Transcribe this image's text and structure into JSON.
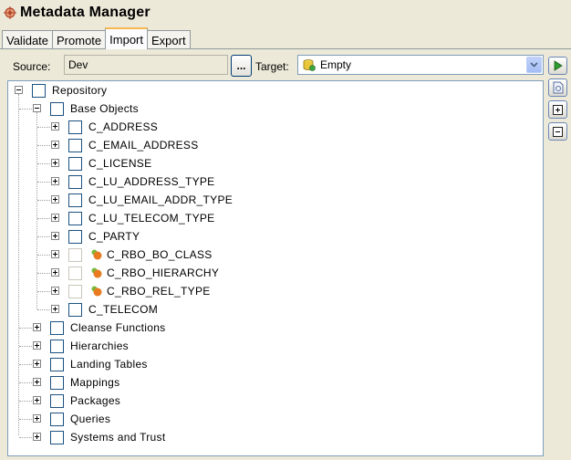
{
  "app": {
    "title": "Metadata Manager"
  },
  "tabs": [
    {
      "label": "Validate",
      "active": false
    },
    {
      "label": "Promote",
      "active": false
    },
    {
      "label": "Import",
      "active": true
    },
    {
      "label": "Export",
      "active": false
    }
  ],
  "source": {
    "label": "Source:",
    "value": "Dev",
    "browse_label": "..."
  },
  "target": {
    "label": "Target:",
    "value": "Empty",
    "icon": "database-icon"
  },
  "side_toolbar": [
    {
      "name": "run-button",
      "icon": "play-icon"
    },
    {
      "name": "properties-button",
      "icon": "document-icon"
    },
    {
      "name": "expand-all-button",
      "icon": "plus-box-icon"
    },
    {
      "name": "collapse-all-button",
      "icon": "minus-box-icon"
    }
  ],
  "tree": {
    "root": {
      "label": "Repository",
      "expanded": true,
      "checked": false
    },
    "base_objects": {
      "label": "Base Objects",
      "expanded": true,
      "items": [
        {
          "label": "C_ADDRESS",
          "type": "object"
        },
        {
          "label": "C_EMAIL_ADDRESS",
          "type": "object"
        },
        {
          "label": "C_LICENSE",
          "type": "object"
        },
        {
          "label": "C_LU_ADDRESS_TYPE",
          "type": "object"
        },
        {
          "label": "C_LU_EMAIL_ADDR_TYPE",
          "type": "object"
        },
        {
          "label": "C_LU_TELECOM_TYPE",
          "type": "object"
        },
        {
          "label": "C_PARTY",
          "type": "object"
        },
        {
          "label": "C_RBO_BO_CLASS",
          "type": "rbo"
        },
        {
          "label": "C_RBO_HIERARCHY",
          "type": "rbo"
        },
        {
          "label": "C_RBO_REL_TYPE",
          "type": "rbo"
        },
        {
          "label": "C_TELECOM",
          "type": "object"
        }
      ]
    },
    "folders": [
      {
        "label": "Cleanse Functions"
      },
      {
        "label": "Hierarchies"
      },
      {
        "label": "Landing Tables"
      },
      {
        "label": "Mappings"
      },
      {
        "label": "Packages"
      },
      {
        "label": "Queries"
      },
      {
        "label": "Systems and Trust"
      }
    ]
  },
  "colors": {
    "accent_tab": "#f7b850",
    "tree_border": "#7f9db9",
    "checkbox_border": "#1c5180",
    "play_green": "#2e9b2e"
  }
}
